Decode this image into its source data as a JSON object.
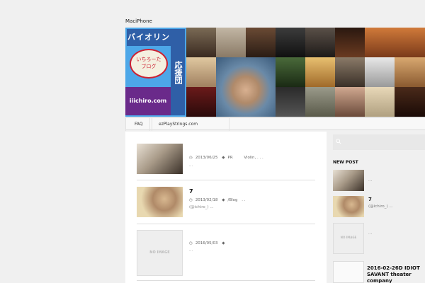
{
  "site": {
    "title": "MaciPhone"
  },
  "banner": {
    "logo_title": "バイオリン",
    "logo_vertical": "応援団",
    "logo_bubble_line1": "いちろーた",
    "logo_bubble_line2": "ブログ",
    "logo_url": "iiichiro.com",
    "colors": {
      "logo_bg": "#4da7e8",
      "logo_dark": "#2f5fa7",
      "bubble_border": "#cc2233",
      "url_bg": "#6a2a8a"
    }
  },
  "nav": {
    "items": [
      {
        "label": "FAQ"
      },
      {
        "label": "ezPlayStrings.com"
      }
    ]
  },
  "posts": [
    {
      "thumb": "violinist-photo",
      "title": "",
      "date": "2013/06/25",
      "tag": "PR",
      "extra": "Violin, . . .",
      "excerpt": "..."
    },
    {
      "thumb": "portrait-photo",
      "title": "7",
      "date": "2013/02/18",
      "tag": "/Blog",
      "extra": ". .",
      "excerpt": "(@ichiro_)  ..."
    },
    {
      "thumb": "no-image",
      "thumb_label": "NO IMAGE",
      "title": "",
      "date": "2016/05/03",
      "tag": "",
      "extra": "",
      "excerpt": "..."
    }
  ],
  "sidebar": {
    "heading": "NEW POST",
    "items": [
      {
        "thumb": "violinist-photo",
        "title": "",
        "sub": "..."
      },
      {
        "thumb": "portrait-photo",
        "title": "7",
        "sub": "(@ichiro_)  ..."
      },
      {
        "thumb": "no-image",
        "thumb_label": "NO IMAGE",
        "title": "",
        "sub": "..."
      }
    ],
    "last": {
      "title": "2016-02-26D IDIOT SAVANT theater company"
    }
  },
  "icons": {
    "clock": "clock-icon",
    "tag": "tag-icon",
    "search": "search-icon"
  }
}
